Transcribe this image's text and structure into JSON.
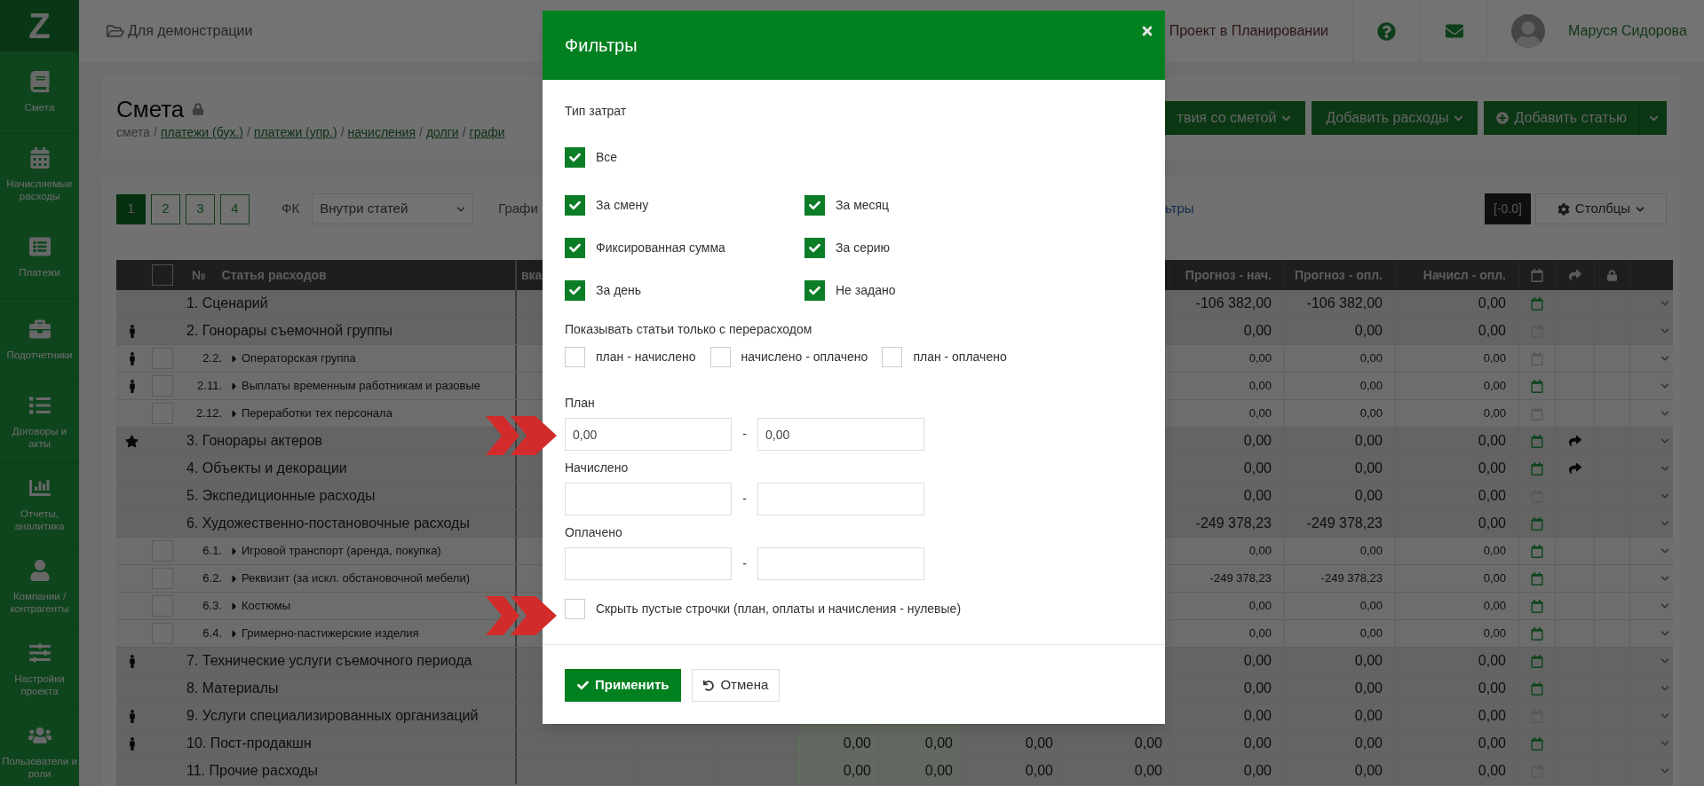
{
  "sidebar": {
    "logo_letter": "Z",
    "items": [
      {
        "label": "Смета"
      },
      {
        "label": "Начисляемые расходы"
      },
      {
        "label": "Платежи"
      },
      {
        "label": "Подотчетники"
      },
      {
        "label": "Договоры и акты"
      },
      {
        "label": "Отчеты, аналитика"
      },
      {
        "label": "Компании / контрагенты"
      },
      {
        "label": "Настройки проекта"
      },
      {
        "label": "Пользователи и роли"
      }
    ]
  },
  "header": {
    "project_folder": "Для демонстрации",
    "project_status": "Проект в Планировании",
    "user_name": "Маруся Сидорова"
  },
  "page": {
    "title": "Смета",
    "breadcrumb": [
      {
        "kind": "text",
        "text": "смета"
      },
      {
        "kind": "separator",
        "text": "/"
      },
      {
        "kind": "link",
        "text": "платежи (бух.)"
      },
      {
        "kind": "separator",
        "text": "/"
      },
      {
        "kind": "link",
        "text": "платежи (упр.)"
      },
      {
        "kind": "separator",
        "text": "/"
      },
      {
        "kind": "link",
        "text": "начисления"
      },
      {
        "kind": "separator",
        "text": "/"
      },
      {
        "kind": "link",
        "text": "долги"
      },
      {
        "kind": "separator",
        "text": "/"
      },
      {
        "kind": "link",
        "text": "графи"
      }
    ],
    "actions": [
      {
        "label": "твия со сметой",
        "kind": "dropdown"
      },
      {
        "label": "Добавить расходы",
        "kind": "dropdown"
      },
      {
        "label": "Добавить статью",
        "kind": "split"
      }
    ]
  },
  "toolbar": {
    "pages": [
      {
        "label": "1",
        "selected": true
      },
      {
        "label": "2",
        "selected": false
      },
      {
        "label": "3",
        "selected": false
      },
      {
        "label": "4",
        "selected": false
      }
    ],
    "fk_label": "ФК",
    "fk_select": "Внутри статей",
    "graph_label": "Графи",
    "filters_link": "ьтры",
    "rounding_button": "[-0.0]",
    "columns_button": "Столбцы"
  },
  "table": {
    "select_all_checked": false,
    "columns": [
      "№",
      "Статья расходов",
      "вка",
      "Прогноз - нач.",
      "Прогноз - опл.",
      "Начисл - опл."
    ],
    "rows": [
      {
        "kind": "section",
        "person": false,
        "starred": false,
        "number": "1.",
        "name": "Сценарий",
        "values": [
          "-106 382,00",
          "-106 382,00",
          "0,00"
        ],
        "scheduled": true,
        "forwarded": false
      },
      {
        "kind": "section",
        "person": true,
        "starred": false,
        "number": "2.",
        "name": "Гонорары съемочной группы",
        "values": [
          "0,00",
          "0,00",
          "0,00"
        ],
        "scheduled": false,
        "forwarded": false
      },
      {
        "kind": "item",
        "person": true,
        "starred": false,
        "checked": false,
        "number": "2.2.",
        "name": "Операторская группа",
        "values": [
          "0,00",
          "0,00",
          "0,00"
        ],
        "scheduled": false,
        "forwarded": false
      },
      {
        "kind": "item",
        "person": true,
        "starred": false,
        "checked": false,
        "number": "2.11.",
        "name": "Выплаты временным работникам и разовые",
        "values": [
          "0,00",
          "0,00",
          "0,00"
        ],
        "scheduled": true,
        "forwarded": false
      },
      {
        "kind": "item",
        "person": false,
        "starred": false,
        "checked": false,
        "number": "2.12.",
        "name": "Переработки тех персонала",
        "values": [
          "0,00",
          "0,00",
          "0,00"
        ],
        "scheduled": false,
        "forwarded": false
      },
      {
        "kind": "section",
        "person": false,
        "starred": true,
        "number": "3.",
        "name": "Гонорары актеров",
        "values": [
          "0,00",
          "0,00",
          "0,00"
        ],
        "scheduled": true,
        "forwarded": true
      },
      {
        "kind": "section",
        "person": false,
        "starred": false,
        "number": "4.",
        "name": "Объекты и декорации",
        "values": [
          "0,00",
          "0,00",
          "0,00"
        ],
        "scheduled": true,
        "forwarded": true
      },
      {
        "kind": "section",
        "person": false,
        "starred": false,
        "number": "5.",
        "name": "Экспедиционные расходы",
        "values": [
          "0,00",
          "0,00",
          "0,00"
        ],
        "scheduled": false,
        "forwarded": false
      },
      {
        "kind": "section",
        "person": false,
        "starred": false,
        "number": "6.",
        "name": "Художественно-постановочные расходы",
        "values": [
          "-249 378,23",
          "-249 378,23",
          "0,00"
        ],
        "scheduled": true,
        "forwarded": false
      },
      {
        "kind": "item",
        "person": false,
        "starred": false,
        "checked": false,
        "number": "6.1.",
        "name": "Игровой транспорт (аренда, покупка)",
        "values": [
          "0,00",
          "0,00",
          "0,00"
        ],
        "scheduled": true,
        "forwarded": false
      },
      {
        "kind": "item",
        "person": false,
        "starred": false,
        "checked": false,
        "number": "6.2.",
        "name": "Реквизит (за искл. обстановочной мебели)",
        "values": [
          "-249 378,23",
          "-249 378,23",
          "0,00"
        ],
        "scheduled": true,
        "forwarded": false
      },
      {
        "kind": "item",
        "person": false,
        "starred": false,
        "checked": false,
        "number": "6.3.",
        "name": "Костюмы",
        "values": [
          "0,00",
          "0,00",
          "0,00"
        ],
        "scheduled": true,
        "forwarded": false
      },
      {
        "kind": "item",
        "person": false,
        "starred": false,
        "checked": false,
        "number": "6.4.",
        "name": "Гримерно-пастижерские изделия",
        "values": [
          "0,00",
          "0,00",
          "0,00"
        ],
        "scheduled": true,
        "forwarded": false
      },
      {
        "kind": "section",
        "person": true,
        "starred": false,
        "number": "7.",
        "name": "Технические услуги съемочного периода",
        "values": [
          "0,00",
          "0,00",
          "0,00"
        ],
        "scheduled": true,
        "forwarded": false
      },
      {
        "kind": "section",
        "person": false,
        "starred": false,
        "number": "8.",
        "name": "Материалы",
        "values": [
          "0,00",
          "0,00",
          "0,00"
        ],
        "scheduled": true,
        "forwarded": false
      },
      {
        "kind": "section",
        "person": true,
        "starred": false,
        "number": "9.",
        "name": "Услуги специализированных организаций",
        "values": [
          "0,00",
          "0,00",
          "0,00"
        ],
        "scheduled": false,
        "forwarded": false
      },
      {
        "kind": "section",
        "person": true,
        "starred": false,
        "number": "10.",
        "name": "Пост-продакшн",
        "middle_values": [
          "0,00",
          "0,00",
          "0,00",
          "0,00"
        ],
        "values": [
          "0,00",
          "0,00",
          "0,00"
        ],
        "scheduled": true,
        "forwarded": false
      },
      {
        "kind": "section",
        "person": false,
        "starred": false,
        "number": "11.",
        "name": "Прочие расходы",
        "middle_values": [
          "0,00",
          "0,00",
          "0,00",
          "0,00"
        ],
        "values": [
          "0,00",
          "0,00",
          "0,00"
        ],
        "scheduled": false,
        "forwarded": false
      }
    ]
  },
  "filter_dialog": {
    "title": "Фильтры",
    "cost_type_label": "Тип затрат",
    "all_option": {
      "label": "Все",
      "checked": true
    },
    "cost_types": [
      {
        "label": "За смену",
        "checked": true
      },
      {
        "label": "За месяц",
        "checked": true
      },
      {
        "label": "Фиксированная сумма",
        "checked": true
      },
      {
        "label": "За серию",
        "checked": true
      },
      {
        "label": "За день",
        "checked": true
      },
      {
        "label": "Не задано",
        "checked": true
      }
    ],
    "overspend_label": "Показывать статьи только с перерасходом",
    "overspend_options": [
      {
        "label": "план - начислено",
        "checked": false
      },
      {
        "label": "начислено - оплачено",
        "checked": false
      },
      {
        "label": "план - оплачено",
        "checked": false
      }
    ],
    "ranges": [
      {
        "label": "План",
        "from": "0,00",
        "separator": "-",
        "to": "0,00"
      },
      {
        "label": "Начислено",
        "separator": "-"
      },
      {
        "label": "Оплачено",
        "separator": "-"
      }
    ],
    "hide_empty": {
      "label": "Скрыть пустые строчки (план, оплаты и начисления - нулевые)",
      "checked": false
    },
    "apply_button": "Применить",
    "cancel_button": "Отмена"
  }
}
